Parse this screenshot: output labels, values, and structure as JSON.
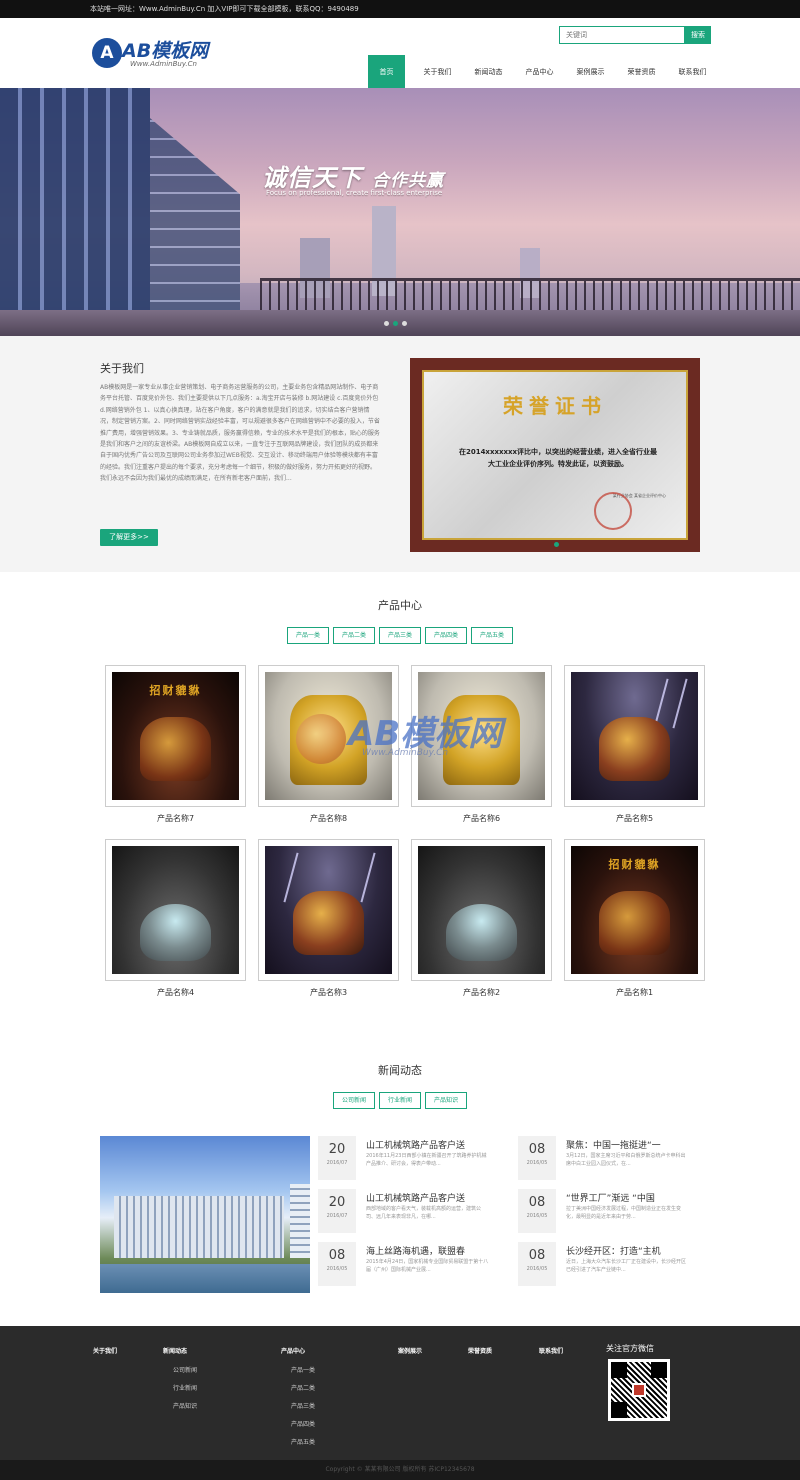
{
  "topbar": {
    "notice": "本站唯一网址：Www.AdminBuy.Cn 加入VIP即可下载全部模板，联系QQ：9490489"
  },
  "header": {
    "logo_text": "AB模板网",
    "logo_mark": "A",
    "logo_domain": "Www.AdminBuy.Cn",
    "search_placeholder": "关键词",
    "search_button": "搜索"
  },
  "nav": [
    "首页",
    "关于我们",
    "新闻动态",
    "产品中心",
    "案例展示",
    "荣誉资质",
    "联系我们"
  ],
  "banner": {
    "headline": "诚信天下",
    "headline2": "合作共赢",
    "tagline": "Focus on professional, create first-class enterprise"
  },
  "about": {
    "title": "关于我们",
    "text": "AB模板网是一家专业从事企业营销策划、电子商务运营服务的公司，主要业务包含精品网站制作、电子商务平台托管、百度竞价外包、我们主要提供以下几点服务：a.淘宝开店与装修 b.网站建设 c.百度竞价外包 d.网络营销外包 1、以真心换真理，站在客户角度，客户的满意就是我们的追求，切实结合客户营销情况，制定营销方案。2、同时网络营销实战经验丰富，可以规避很多客户在网络营销中不必要的投入，节省推广费用，增强营销效果。3、专业铸就品质，服务赢得信赖，专业的技术水平是我们的根本，贴心的服务是我们和客户之间的友谊桥梁。AB模板网自成立以来，一直专注于互联网品牌建设，我们团队的成员都来自于国内优秀广告公司及互联网公司业务参加过WEB视觉、交互设计、移动终端用户体验等模块都有丰富的经验。我们注重客户提出的每个要求，充分考虑每一个细节，积极的做好服务，努力开拓更好的视野。我们永远不会因为我们最优的成绩而满足，在所有新老客户面前，我们...",
    "more_button": "了解更多>>"
  },
  "certificate": {
    "title": "荣誉证书",
    "body": "在2014xxxxxxx评比中，以突出的经营业绩，进入全省行业最大工业企业评价序列。特发此证，以资鼓励。",
    "issuer": "某行业协会 某省企业评价中心"
  },
  "products": {
    "title": "产品中心",
    "tabs": [
      "产品一类",
      "产品二类",
      "产品三类",
      "产品四类",
      "产品五类"
    ],
    "items": [
      {
        "name": "产品名称7",
        "style": "dark",
        "caption": "招财貔貅"
      },
      {
        "name": "产品名称8",
        "style": "gold",
        "caption": ""
      },
      {
        "name": "产品名称6",
        "style": "gold",
        "caption": ""
      },
      {
        "name": "产品名称5",
        "style": "storm",
        "caption": ""
      },
      {
        "name": "产品名称4",
        "style": "tea",
        "caption": ""
      },
      {
        "name": "产品名称3",
        "style": "storm",
        "caption": ""
      },
      {
        "name": "产品名称2",
        "style": "tea",
        "caption": ""
      },
      {
        "name": "产品名称1",
        "style": "dark",
        "caption": "招财貔貅"
      }
    ],
    "watermark_text": "AB模板网",
    "watermark_url": "Www.AdminBuy.Cn"
  },
  "news": {
    "title": "新闻动态",
    "tabs": [
      "公司新闻",
      "行业新闻",
      "产品知识"
    ],
    "left": [
      {
        "day": "20",
        "ym": "2016/07",
        "title": "山工机械筑路产品客户送",
        "desc": "2016年11月23日西部小镇在新疆召开了筑路养护机械产品推介、研讨会，得表户带动..."
      },
      {
        "day": "20",
        "ym": "2016/07",
        "title": "山工机械筑路产品客户送",
        "desc": "西部地域的客户看天气，装载机高额的运营，建筑公司、远几年来表现非凡，在哪..."
      },
      {
        "day": "08",
        "ym": "2016/05",
        "title": "海上丝路海机遇，联盟春",
        "desc": "2015年4月24日，国家机械专业国际贸易联盟于第十八届（广州）国际机械产业展..."
      }
    ],
    "right": [
      {
        "day": "08",
        "ym": "2016/05",
        "title": "聚焦：中国一拖挺进“一",
        "desc": "3月12日，国家主席习近平和白俄罗斯总统卢卡申科出席中白工业园入园仪式，在..."
      },
      {
        "day": "08",
        "ym": "2016/05",
        "title": "“世界工厂”渐远 “中国",
        "desc": "拉丁美洲中国经济发展过程，中国制造业正在发生变化，最明显的是近年来由于劳..."
      },
      {
        "day": "08",
        "ym": "2016/05",
        "title": "长沙经开区：打造“主机",
        "desc": "近日，上海大众汽车长沙工厂正在建设中，长沙经开区已经引进了汽车产业链中..."
      }
    ]
  },
  "footer": {
    "columns": [
      {
        "head": "关于我们",
        "links": []
      },
      {
        "head": "新闻动态",
        "links": [
          "公司新闻",
          "行业新闻",
          "产品知识"
        ]
      },
      {
        "head": "产品中心",
        "links": [
          "产品一类",
          "产品二类",
          "产品三类",
          "产品四类",
          "产品五类"
        ]
      },
      {
        "head": "案例展示",
        "links": []
      },
      {
        "head": "荣誉资质",
        "links": []
      },
      {
        "head": "联系我们",
        "links": []
      }
    ],
    "wechat_title": "关注官方微信",
    "copyright": "Copyright © 某某有限公司 版权所有 苏ICP12345678"
  },
  "colors": {
    "accent": "#1aa57c",
    "footer_bg": "#2b2b2b",
    "topbar_bg": "#111111"
  }
}
